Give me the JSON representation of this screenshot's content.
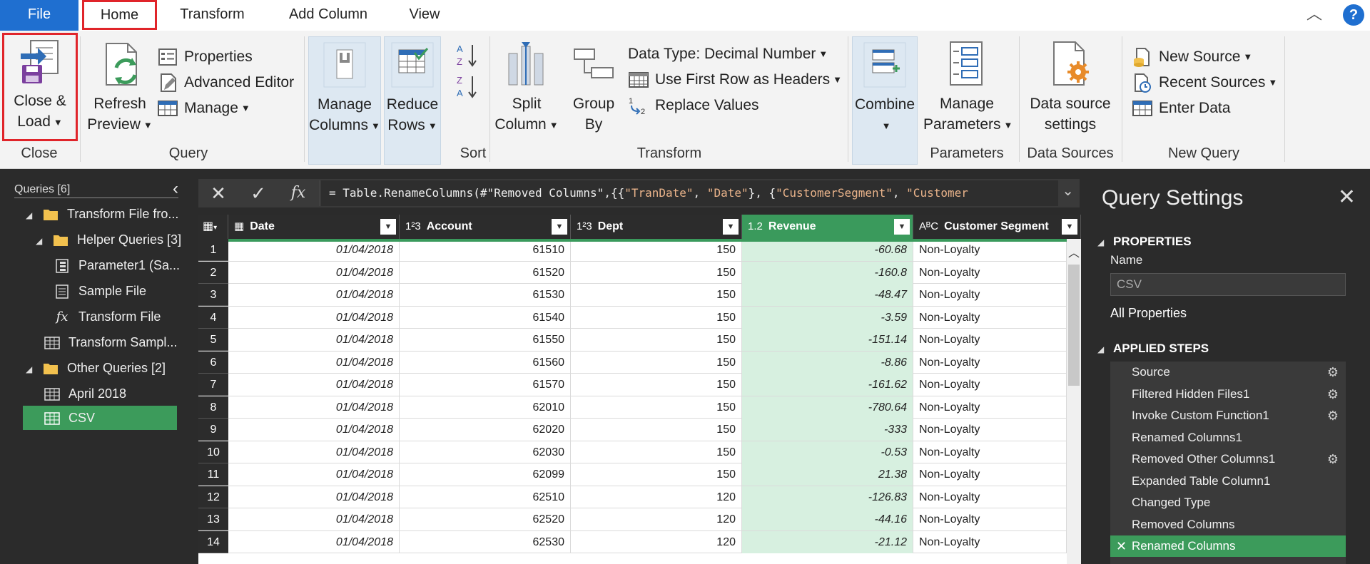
{
  "menu": {
    "file": "File",
    "home": "Home",
    "transform": "Transform",
    "add_column": "Add Column",
    "view": "View",
    "help": "?"
  },
  "ribbon": {
    "close_group": {
      "label": "Close",
      "close_load": [
        "Close &",
        "Load"
      ]
    },
    "query_group": {
      "label": "Query",
      "refresh_preview": [
        "Refresh",
        "Preview"
      ],
      "properties": "Properties",
      "advanced_editor": "Advanced Editor",
      "manage": "Manage"
    },
    "manage_columns": [
      "Manage",
      "Columns"
    ],
    "reduce_rows": [
      "Reduce",
      "Rows"
    ],
    "sort_group": {
      "label": "Sort"
    },
    "transform_group": {
      "label": "Transform",
      "split_column": [
        "Split",
        "Column"
      ],
      "group_by": [
        "Group",
        "By"
      ],
      "data_type": "Data Type: Decimal Number",
      "first_row_headers": "Use First Row as Headers",
      "replace_values": "Replace Values"
    },
    "combine": "Combine",
    "parameters_group": {
      "label": "Parameters",
      "manage_parameters": [
        "Manage",
        "Parameters"
      ]
    },
    "data_sources_group": {
      "label": "Data Sources",
      "settings": [
        "Data source",
        "settings"
      ]
    },
    "new_query_group": {
      "label": "New Query",
      "new_source": "New Source",
      "recent_sources": "Recent Sources",
      "enter_data": "Enter Data"
    }
  },
  "queries": {
    "title": "Queries [6]",
    "items": [
      "Transform File fro...",
      "Helper Queries [3]",
      "Parameter1 (Sa...",
      "Sample File",
      "Transform File",
      "Transform Sampl...",
      "Other Queries [2]",
      "April 2018",
      "CSV"
    ]
  },
  "formula": {
    "prefix": "= Table.RenameColumns(#\"Removed Columns\",{{",
    "s1": "\"TranDate\"",
    "sep1": ", ",
    "s2": "\"Date\"",
    "sep2": "}, {",
    "s3": "\"CustomerSegment\"",
    "sep3": ", ",
    "s4": "\"Customer",
    "fx": "fx"
  },
  "table": {
    "columns": [
      {
        "type": "▦",
        "name": "Date"
      },
      {
        "type": "1²3",
        "name": "Account"
      },
      {
        "type": "1²3",
        "name": "Dept"
      },
      {
        "type": "1.2",
        "name": "Revenue"
      },
      {
        "type": "AᴮC",
        "name": "Customer Segment"
      }
    ],
    "rows": [
      [
        "1",
        "01/04/2018",
        "61510",
        "150",
        "-60.68",
        "Non-Loyalty"
      ],
      [
        "2",
        "01/04/2018",
        "61520",
        "150",
        "-160.8",
        "Non-Loyalty"
      ],
      [
        "3",
        "01/04/2018",
        "61530",
        "150",
        "-48.47",
        "Non-Loyalty"
      ],
      [
        "4",
        "01/04/2018",
        "61540",
        "150",
        "-3.59",
        "Non-Loyalty"
      ],
      [
        "5",
        "01/04/2018",
        "61550",
        "150",
        "-151.14",
        "Non-Loyalty"
      ],
      [
        "6",
        "01/04/2018",
        "61560",
        "150",
        "-8.86",
        "Non-Loyalty"
      ],
      [
        "7",
        "01/04/2018",
        "61570",
        "150",
        "-161.62",
        "Non-Loyalty"
      ],
      [
        "8",
        "01/04/2018",
        "62010",
        "150",
        "-780.64",
        "Non-Loyalty"
      ],
      [
        "9",
        "01/04/2018",
        "62020",
        "150",
        "-333",
        "Non-Loyalty"
      ],
      [
        "10",
        "01/04/2018",
        "62030",
        "150",
        "-0.53",
        "Non-Loyalty"
      ],
      [
        "11",
        "01/04/2018",
        "62099",
        "150",
        "21.38",
        "Non-Loyalty"
      ],
      [
        "12",
        "01/04/2018",
        "62510",
        "120",
        "-126.83",
        "Non-Loyalty"
      ],
      [
        "13",
        "01/04/2018",
        "62520",
        "120",
        "-44.16",
        "Non-Loyalty"
      ],
      [
        "14",
        "01/04/2018",
        "62530",
        "120",
        "-21.12",
        "Non-Loyalty"
      ]
    ]
  },
  "settings": {
    "title": "Query Settings",
    "properties": "PROPERTIES",
    "name_label": "Name",
    "name_value": "CSV",
    "all_properties": "All Properties",
    "applied_steps": "APPLIED STEPS",
    "steps": [
      {
        "label": "Source",
        "gear": true
      },
      {
        "label": "Filtered Hidden Files1",
        "gear": true
      },
      {
        "label": "Invoke Custom Function1",
        "gear": true
      },
      {
        "label": "Renamed Columns1",
        "gear": false
      },
      {
        "label": "Removed Other Columns1",
        "gear": true
      },
      {
        "label": "Expanded Table Column1",
        "gear": false
      },
      {
        "label": "Changed Type",
        "gear": false
      },
      {
        "label": "Removed Columns",
        "gear": false
      },
      {
        "label": "Renamed Columns",
        "gear": false,
        "selected": true
      }
    ]
  },
  "colors": {
    "accent_green": "#3c9b5b",
    "file_blue": "#1f6fd0",
    "highlight_red": "#e0242a"
  }
}
